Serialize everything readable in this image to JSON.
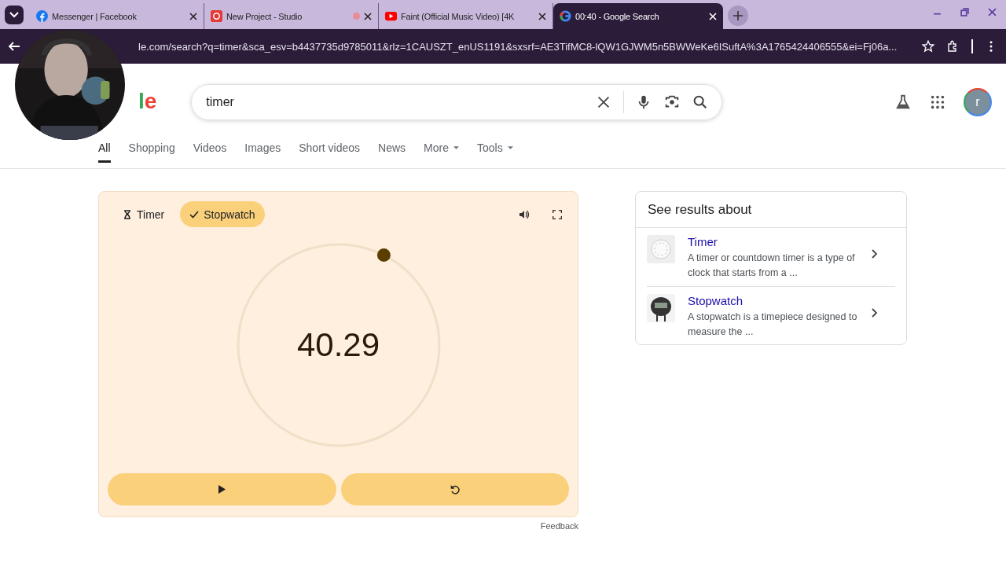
{
  "browser": {
    "tabs": [
      {
        "title": "Messenger | Facebook",
        "selected": false,
        "recording": false
      },
      {
        "title": "New Project - Studio",
        "selected": false,
        "recording": true
      },
      {
        "title": "Faint (Official Music Video) [4K",
        "selected": false,
        "recording": false
      },
      {
        "title": "00:40 - Google Search",
        "selected": true,
        "recording": false
      }
    ],
    "url": "le.com/search?q=timer&sca_esv=b4437735d9785011&rlz=1CAUSZT_enUS1191&sxsrf=AE3TifMC8-lQW1GJWM5n5BWWeKe6ISuftA%3A1765424406555&ei=Fj06a..."
  },
  "logo": "le",
  "search": {
    "value": "timer"
  },
  "avatar": "r",
  "nav": [
    {
      "label": "All",
      "selected": true,
      "dropdown": false
    },
    {
      "label": "Shopping",
      "selected": false,
      "dropdown": false
    },
    {
      "label": "Videos",
      "selected": false,
      "dropdown": false
    },
    {
      "label": "Images",
      "selected": false,
      "dropdown": false
    },
    {
      "label": "Short videos",
      "selected": false,
      "dropdown": false
    },
    {
      "label": "News",
      "selected": false,
      "dropdown": false
    },
    {
      "label": "More",
      "selected": false,
      "dropdown": true
    },
    {
      "label": "Tools",
      "selected": false,
      "dropdown": true
    }
  ],
  "stopwatch": {
    "modes": [
      {
        "label": "Timer",
        "selected": false
      },
      {
        "label": "Stopwatch",
        "selected": true
      }
    ],
    "time": "40.29",
    "feedback": "Feedback"
  },
  "see_results": {
    "title": "See results about",
    "items": [
      {
        "kind": "timer",
        "title": "Timer",
        "description": "A timer or countdown timer is a type of clock that starts from a ..."
      },
      {
        "kind": "stopwatch",
        "title": "Stopwatch",
        "description": "A stopwatch is a timepiece designed to measure the ..."
      }
    ]
  }
}
